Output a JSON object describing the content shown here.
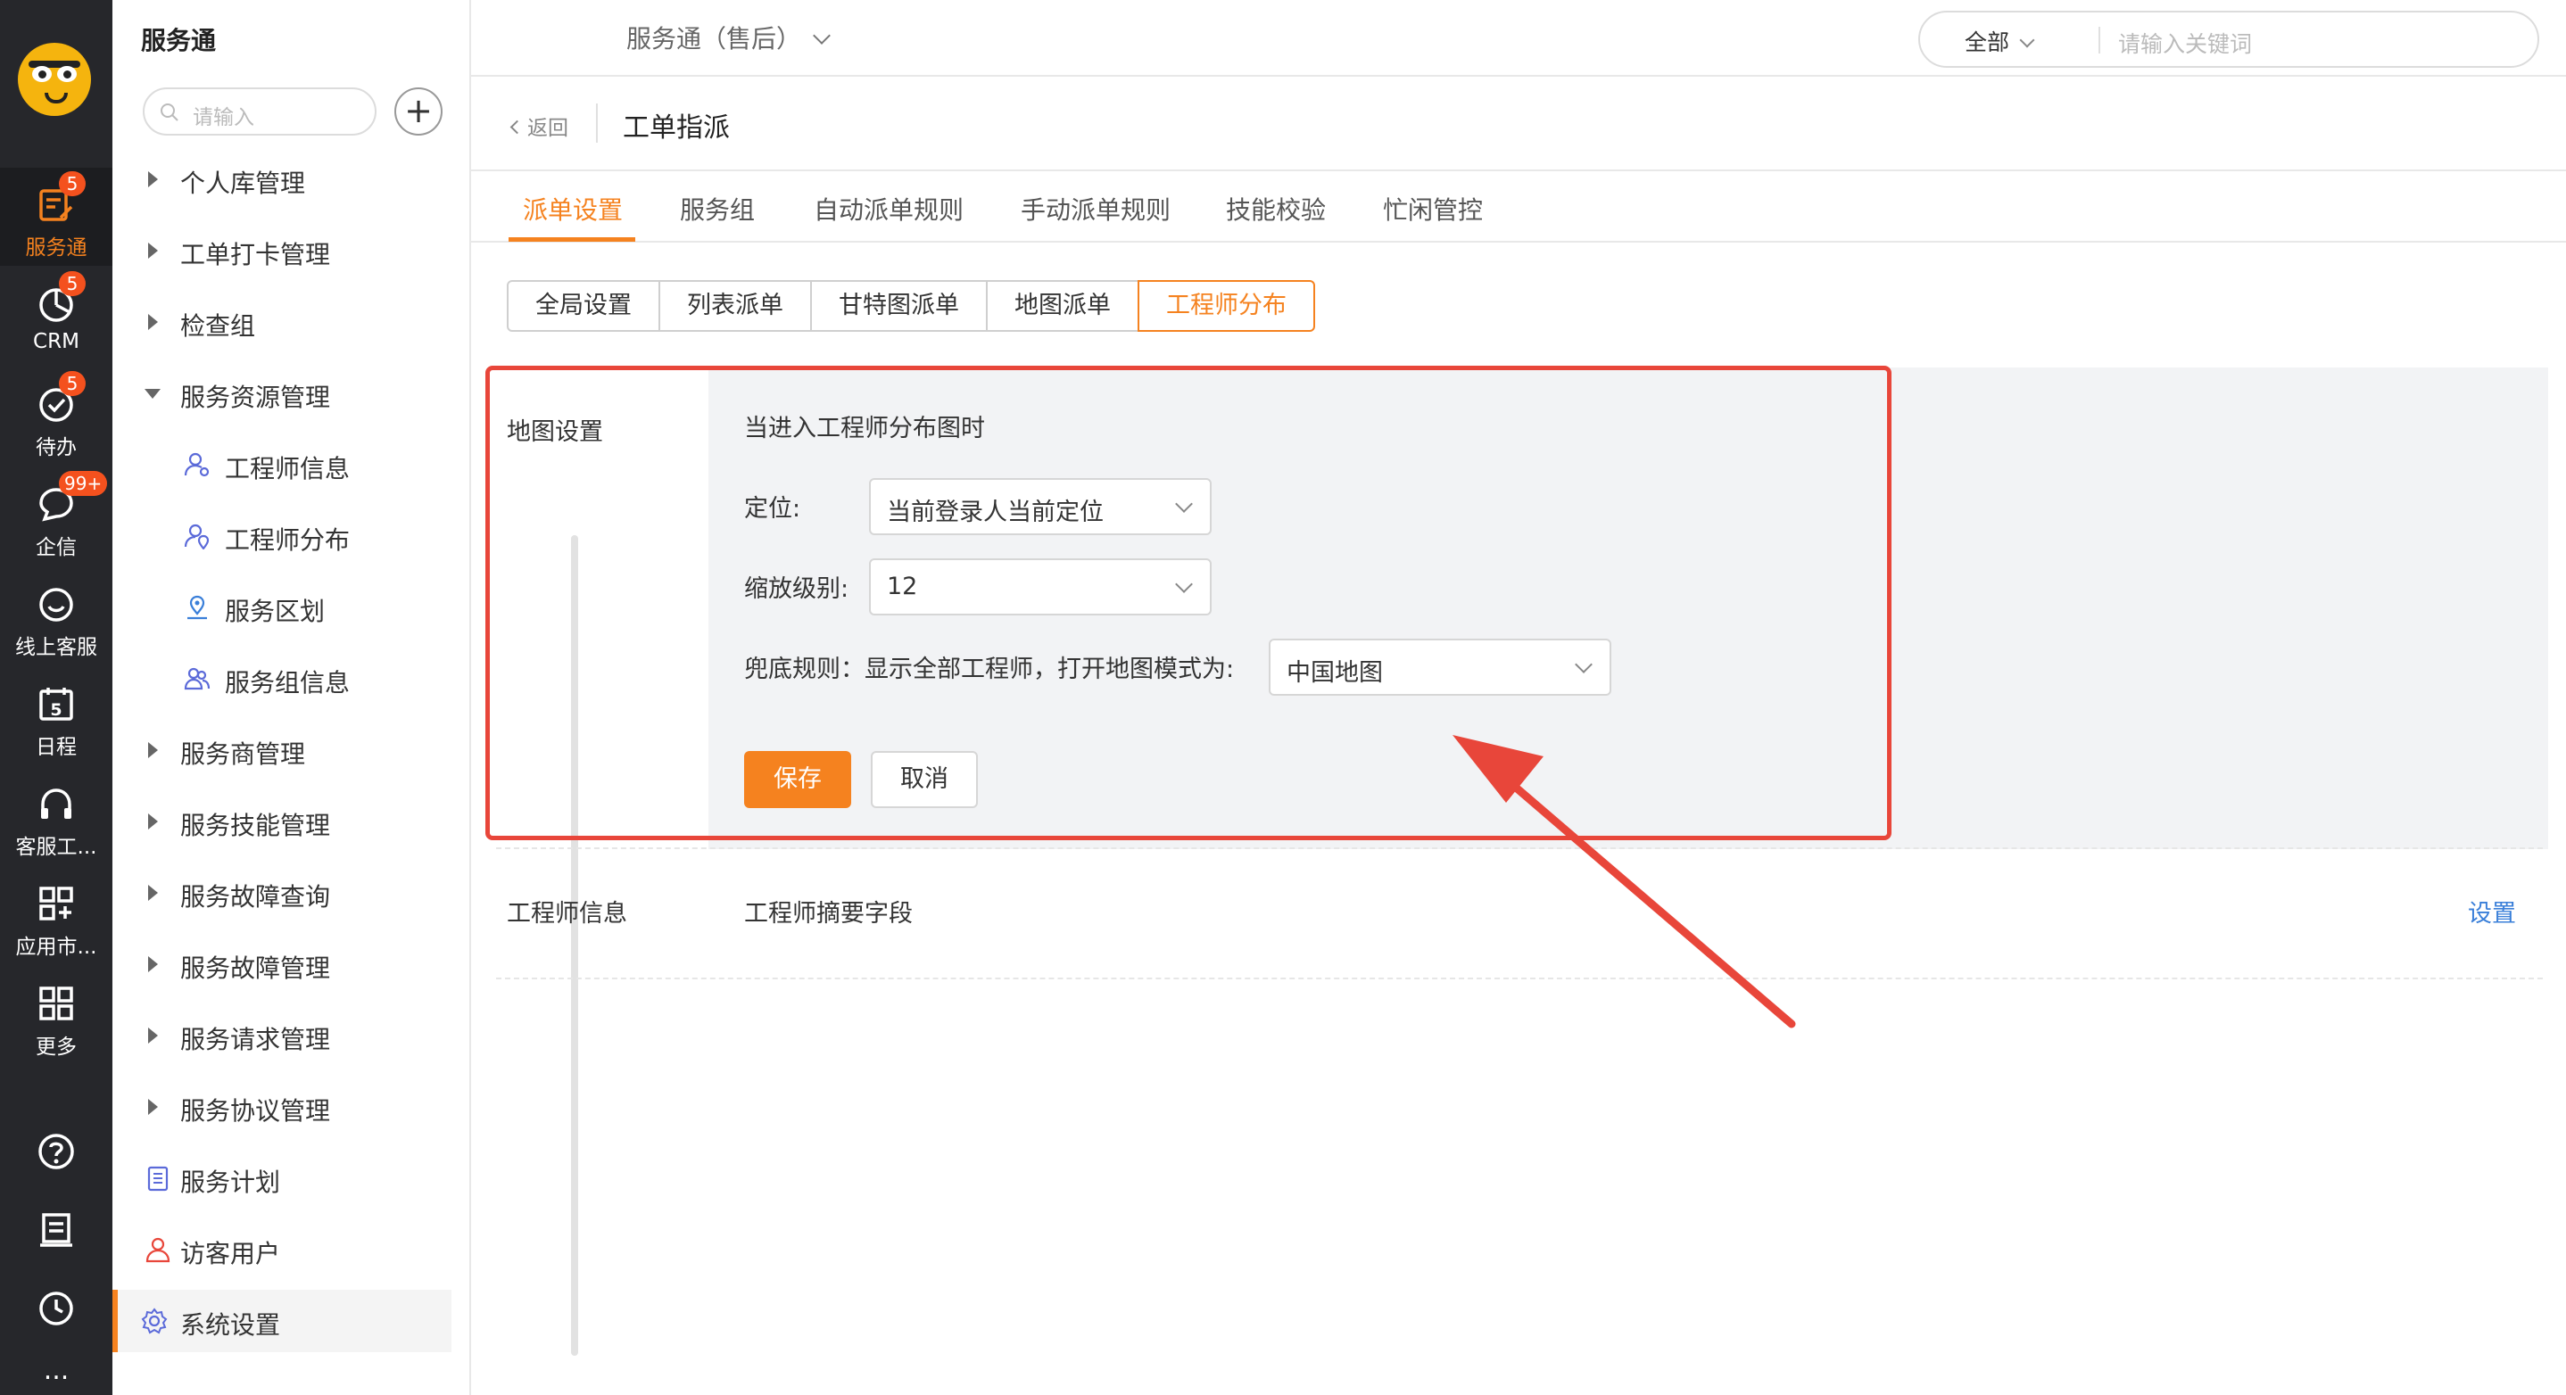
{
  "rail": {
    "items": [
      {
        "label": "服务通",
        "badge": "5",
        "icon": "service-icon"
      },
      {
        "label": "CRM",
        "badge": "5",
        "icon": "crm-pie-icon"
      },
      {
        "label": "待办",
        "badge": "5",
        "icon": "todo-check-icon"
      },
      {
        "label": "企信",
        "badge": "99+",
        "icon": "chat-bubble-icon"
      },
      {
        "label": "线上客服",
        "badge": "",
        "icon": "smile-chat-icon"
      },
      {
        "label": "日程",
        "badge": "",
        "icon": "calendar-icon"
      },
      {
        "label": "客服工...",
        "badge": "",
        "icon": "headset-icon"
      },
      {
        "label": "应用市...",
        "badge": "",
        "icon": "app-market-icon"
      },
      {
        "label": "更多",
        "badge": "",
        "icon": "grid-more-icon"
      }
    ],
    "calendar_day": "5",
    "more_dots": "..."
  },
  "nav": {
    "title": "服务通",
    "search_placeholder": "请输入",
    "add_label": "+",
    "items": [
      {
        "label": "个人库管理"
      },
      {
        "label": "工单打卡管理"
      },
      {
        "label": "检查组"
      },
      {
        "label": "服务资源管理"
      },
      {
        "label": "工程师信息"
      },
      {
        "label": "工程师分布"
      },
      {
        "label": "服务区划"
      },
      {
        "label": "服务组信息"
      },
      {
        "label": "服务商管理"
      },
      {
        "label": "服务技能管理"
      },
      {
        "label": "服务故障查询"
      },
      {
        "label": "服务故障管理"
      },
      {
        "label": "服务请求管理"
      },
      {
        "label": "服务协议管理"
      },
      {
        "label": "服务计划"
      },
      {
        "label": "访客用户"
      },
      {
        "label": "系统设置"
      }
    ]
  },
  "topbar": {
    "service_select": "服务通（售后）",
    "search_scope": "全部",
    "search_placeholder": "请输入关键词"
  },
  "page": {
    "back_label": "返回",
    "title": "工单指派",
    "tabs": [
      "派单设置",
      "服务组",
      "自动派单规则",
      "手动派单规则",
      "技能校验",
      "忙闲管控"
    ],
    "segments": [
      "全局设置",
      "列表派单",
      "甘特图派单",
      "地图派单",
      "工程师分布"
    ]
  },
  "map_settings": {
    "section_label": "地图设置",
    "heading": "当进入工程师分布图时",
    "location_label": "定位:",
    "location_value": "当前登录人当前定位",
    "zoom_label": "缩放级别:",
    "zoom_value": "12",
    "fallback_label": "兜底规则：显示全部工程师，打开地图模式为:",
    "fallback_value": "中国地图",
    "save_label": "保存",
    "cancel_label": "取消"
  },
  "engineer_info": {
    "section_label": "工程师信息",
    "field_label": "工程师摘要字段",
    "setting_link": "设置"
  },
  "colors": {
    "accent": "#f5821f",
    "annotation": "#e8463a",
    "link": "#3a7fd9",
    "rail_bg": "#26272b"
  }
}
